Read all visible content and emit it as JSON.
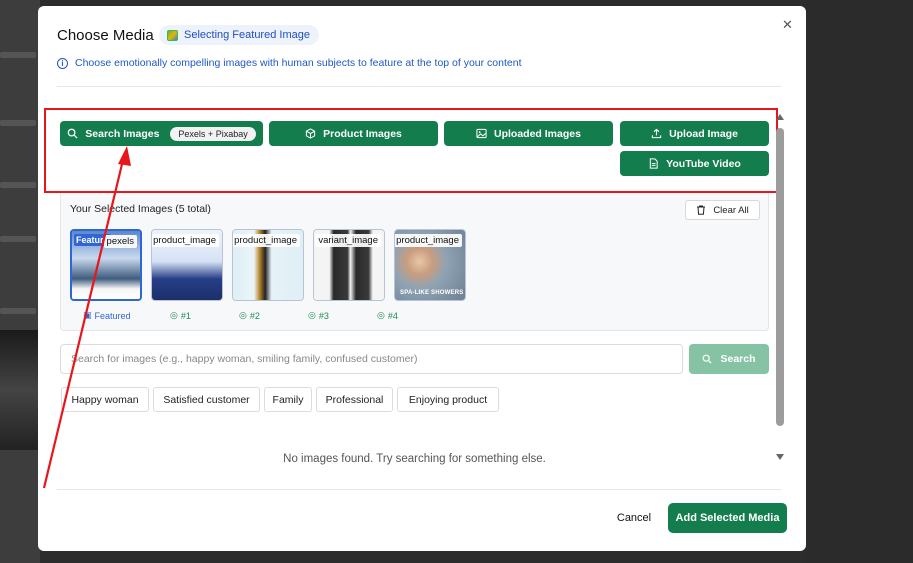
{
  "modal": {
    "title": "Choose Media",
    "badge": "Selecting Featured Image",
    "hint": "Choose emotionally compelling images with human subjects to feature at the top of your content",
    "close_icon": "close-icon"
  },
  "tabs": [
    {
      "label": "Search Images",
      "pill": "Pexels + Pixabay",
      "icon": "search-icon"
    },
    {
      "label": "Product Images",
      "icon": "cube-icon"
    },
    {
      "label": "Uploaded Images",
      "icon": "image-icon"
    },
    {
      "label": "Upload Image",
      "icon": "upload-icon"
    },
    {
      "label": "YouTube Video",
      "icon": "file-icon"
    }
  ],
  "selected": {
    "title": "Your Selected Images (5 total)",
    "clear_label": "Clear All",
    "images": [
      {
        "tag": "pexels",
        "featured_tag": "Feature",
        "caption": "Featured"
      },
      {
        "tag": "product_image",
        "caption": "#1"
      },
      {
        "tag": "product_image",
        "caption": "#2"
      },
      {
        "tag": "variant_image",
        "caption": "#3"
      },
      {
        "tag": "product_image",
        "caption": "#4",
        "overlay_text": "SPA-LIKE SHOWERS"
      }
    ]
  },
  "search": {
    "placeholder": "Search for images (e.g., happy woman, smiling family, confused customer)",
    "button_label": "Search"
  },
  "chips": [
    "Happy woman",
    "Satisfied customer",
    "Family",
    "Professional",
    "Enjoying product"
  ],
  "empty_message": "No images found. Try searching for something else.",
  "footer": {
    "cancel_label": "Cancel",
    "add_label": "Add Selected Media"
  },
  "colors": {
    "primary": "#137d4e",
    "primary_disabled": "#86c3a5",
    "accent_blue": "#2f66d6",
    "annotation_red": "#e8151b"
  }
}
